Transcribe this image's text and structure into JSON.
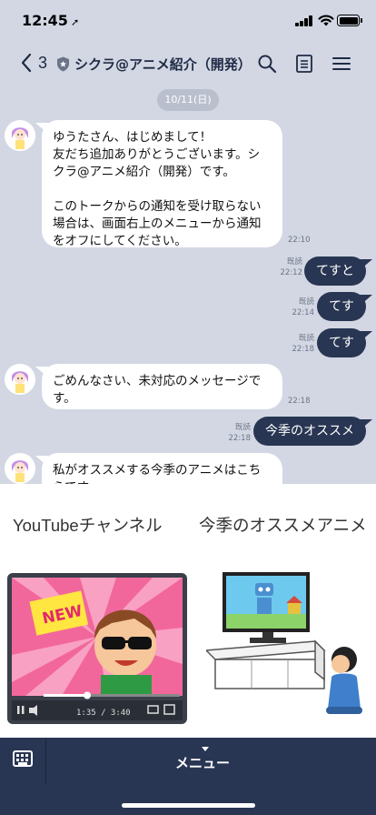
{
  "status_bar": {
    "time": "12:45",
    "location_glyph": "➚"
  },
  "header": {
    "back_count": "3",
    "title": "シクラ@アニメ紹介（開発）",
    "icons": [
      "back-chevron-icon",
      "shield-icon",
      "search-icon",
      "notes-icon",
      "menu-icon"
    ]
  },
  "chat": {
    "date": "10/11(日)",
    "messages": [
      {
        "side": "in",
        "text": "ゆうたさん、はじめまして！\n友だち追加ありがとうございます。シクラ@アニメ紹介（開発）です。\n\nこのトークからの通知を受け取らない場合は、画面右上のメニューから通知をオフにしてください。",
        "time": "22:10"
      },
      {
        "side": "out",
        "text": "てすと",
        "read": "既読",
        "time": "22:12"
      },
      {
        "side": "out",
        "text": "てす",
        "read": "既読",
        "time": "22:14"
      },
      {
        "side": "out",
        "text": "てす",
        "read": "既読",
        "time": "22:18"
      },
      {
        "side": "in",
        "text": "ごめんなさい、未対応のメッセージです。",
        "time": "22:18"
      },
      {
        "side": "out",
        "text": "今季のオススメ",
        "read": "既読",
        "time": "22:18"
      },
      {
        "side": "in",
        "text": "私がオススメする今季のアニメはこちらです"
      }
    ]
  },
  "rich_menu": {
    "left_label": "YouTubeチャンネル",
    "right_label": "今季のオススメアニメ",
    "video_badge": "NEW",
    "video_time": "1:35 / 3:40"
  },
  "menu_bar": {
    "label": "メニュー"
  },
  "colors": {
    "chat_bg": "#d2d7e3",
    "outgoing_bubble": "#283653",
    "menu_bar": "#283653"
  }
}
